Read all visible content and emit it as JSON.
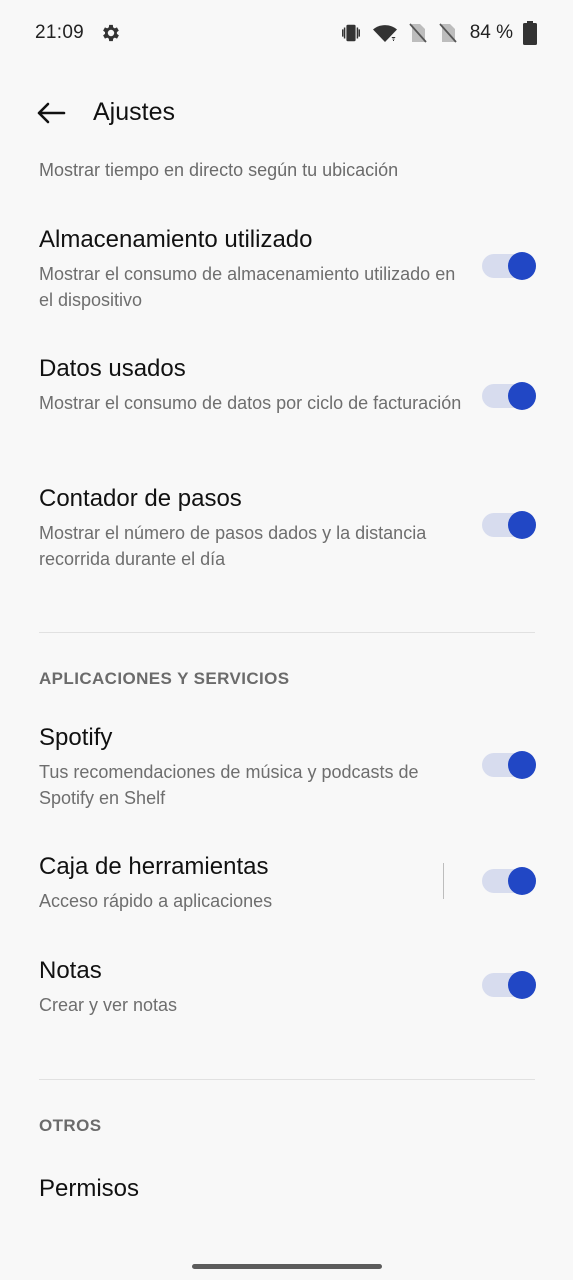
{
  "status_bar": {
    "time": "21:09",
    "battery": "84 %",
    "icons": [
      "settings-gear-icon",
      "vibrate-icon",
      "wifi-icon",
      "no-sim-icon",
      "no-sim-icon",
      "battery-icon"
    ]
  },
  "app_bar": {
    "title": "Ajustes",
    "back_icon": "back-arrow-icon"
  },
  "cut_item_subtitle": "Mostrar tiempo en directo según tu ubicación",
  "items_top": [
    {
      "title": "Almacenamiento utilizado",
      "subtitle": "Mostrar el consumo de almacenamiento utilizado en el dispositivo",
      "enabled": true
    },
    {
      "title": "Datos usados",
      "subtitle": "Mostrar el consumo de datos por ciclo de facturación",
      "enabled": true
    },
    {
      "title": "Contador de pasos",
      "subtitle": "Mostrar el número de pasos dados y la distancia recorrida durante el día",
      "enabled": true
    }
  ],
  "section_apps": {
    "header": "APLICACIONES Y SERVICIOS",
    "items": [
      {
        "title": "Spotify",
        "subtitle": "Tus recomendaciones de música y podcasts de Spotify en Shelf",
        "enabled": true
      },
      {
        "title": "Caja de herramientas",
        "subtitle": "Acceso rápido a aplicaciones",
        "enabled": true
      },
      {
        "title": "Notas",
        "subtitle": "Crear y ver notas",
        "enabled": true
      }
    ]
  },
  "section_other": {
    "header": "OTROS",
    "items": [
      {
        "title": "Permisos"
      }
    ]
  },
  "colors": {
    "accent": "#2147c5",
    "track": "#d7dcee",
    "background": "#f8f8f8"
  }
}
